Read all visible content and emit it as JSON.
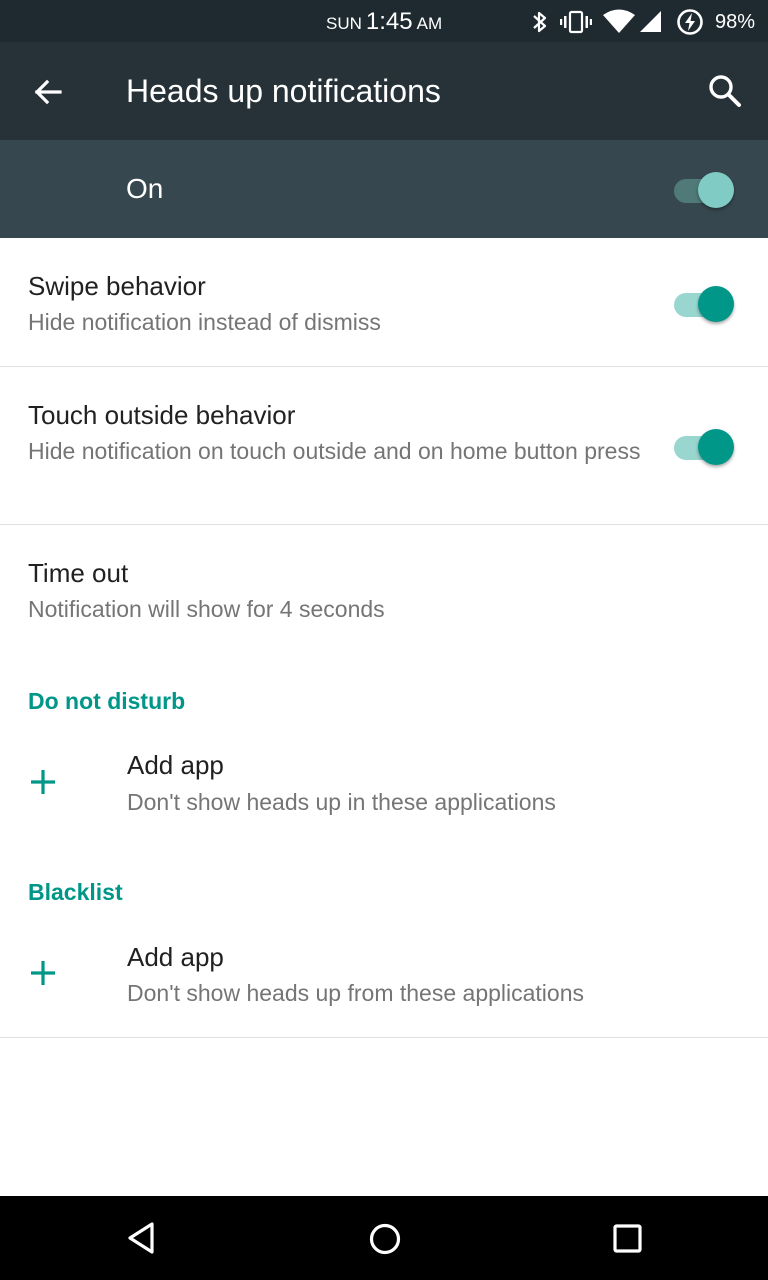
{
  "status_bar": {
    "day": "SUN",
    "time": "1:45",
    "ampm": "AM",
    "battery": "98%",
    "icons": [
      "bluetooth-icon",
      "vibrate-icon",
      "wifi-icon",
      "signal-icon",
      "battery-charging-icon"
    ]
  },
  "toolbar": {
    "title": "Heads up notifications",
    "back_icon": "arrow-back-icon",
    "search_icon": "search-icon"
  },
  "master_switch": {
    "label": "On",
    "checked": true
  },
  "preferences": [
    {
      "title": "Swipe behavior",
      "summary": "Hide notification instead of dismiss",
      "checked": true
    },
    {
      "title": "Touch outside behavior",
      "summary": "Hide notification on touch outside and on home button press",
      "checked": true
    },
    {
      "title": "Time out",
      "summary": "Notification will show for 4 seconds"
    }
  ],
  "sections": [
    {
      "header": "Do not disturb",
      "add_title": "Add app",
      "add_summary": "Don't show heads up in these applications"
    },
    {
      "header": "Blacklist",
      "add_title": "Add app",
      "add_summary": "Don't show heads up from these applications"
    }
  ],
  "colors": {
    "accent": "#009688",
    "toolbar": "#263238",
    "master_bar": "#37474f"
  },
  "nav_bar": {
    "icons": [
      "back-triangle-icon",
      "home-circle-icon",
      "recents-square-icon"
    ]
  }
}
